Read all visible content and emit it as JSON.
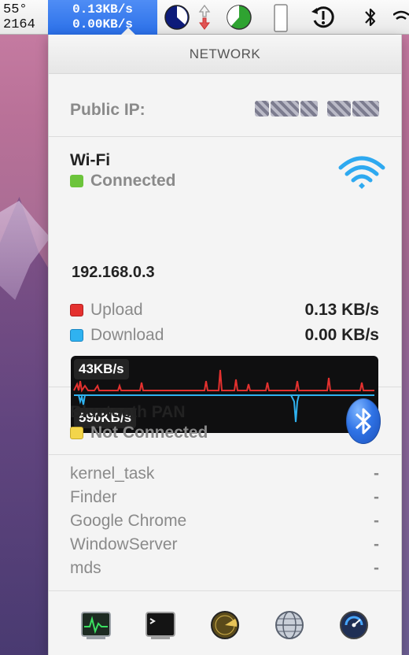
{
  "menubar": {
    "temp": "55°",
    "fan": "2164",
    "upload_rate": "0.13KB/s",
    "download_rate": "0.00KB/s",
    "icons": [
      "cpu-pie-icon",
      "network-arrows-icon",
      "memory-pie-icon",
      "battery-icon",
      "time-machine-icon",
      "bluetooth-icon",
      "wifi-icon"
    ]
  },
  "panel": {
    "header": "NETWORK",
    "public_ip_label": "Public IP:",
    "wifi": {
      "title": "Wi-Fi",
      "status": "Connected",
      "status_color": "#6cc43b",
      "ip": "192.168.0.3",
      "upload_label": "Upload",
      "upload_value": "0.13 KB/s",
      "upload_color": "#e4312f",
      "download_label": "Download",
      "download_value": "0.00 KB/s",
      "download_color": "#2fb2f0",
      "graph_top": "43KB/s",
      "graph_bottom": "590KB/s"
    },
    "bluetooth": {
      "title": "Bluetooth PAN",
      "status": "Not Connected",
      "status_color": "#f3d54a"
    },
    "processes": [
      {
        "name": "kernel_task",
        "value": "-"
      },
      {
        "name": "Finder",
        "value": "-"
      },
      {
        "name": "Google Chrome",
        "value": "-"
      },
      {
        "name": "WindowServer",
        "value": "-"
      },
      {
        "name": "mds",
        "value": "-"
      }
    ],
    "toolbar_icons": [
      "activity-monitor-icon",
      "terminal-icon",
      "radar-icon",
      "network-utility-icon",
      "disk-utility-icon"
    ]
  }
}
